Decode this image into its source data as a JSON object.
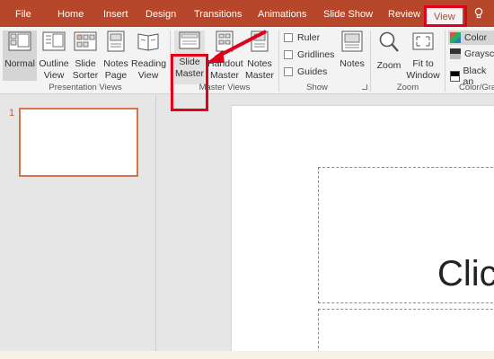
{
  "tabs": {
    "file": "File",
    "home": "Home",
    "insert": "Insert",
    "design": "Design",
    "transitions": "Transitions",
    "animations": "Animations",
    "slide_show": "Slide Show",
    "review": "Review",
    "view": "View"
  },
  "tell_me_icon": "lightbulb-icon",
  "ribbon": {
    "presentation_views": {
      "label": "Presentation Views",
      "normal": "Normal",
      "outline_l1": "Outline",
      "outline_l2": "View",
      "slide_sorter_l1": "Slide",
      "slide_sorter_l2": "Sorter",
      "notes_page_l1": "Notes",
      "notes_page_l2": "Page",
      "reading_l1": "Reading",
      "reading_l2": "View"
    },
    "master_views": {
      "label": "Master Views",
      "slide_master_l1": "Slide",
      "slide_master_l2": "Master",
      "handout_l1": "Handout",
      "handout_l2": "Master",
      "notes_master_l1": "Notes",
      "notes_master_l2": "Master"
    },
    "show": {
      "label": "Show",
      "ruler": "Ruler",
      "gridlines": "Gridlines",
      "guides": "Guides",
      "notes": "Notes"
    },
    "zoom": {
      "label": "Zoom",
      "zoom": "Zoom",
      "fit_l1": "Fit to",
      "fit_l2": "Window"
    },
    "color": {
      "label": "Color/Gra",
      "color": "Color",
      "grayscale": "Grayscale",
      "black_white": "Black an"
    }
  },
  "thumbnails": {
    "slide_number": "1"
  },
  "slide": {
    "title_placeholder": "Clic"
  },
  "colors": {
    "accent": "#b7472a",
    "highlight": "#e0001a"
  }
}
